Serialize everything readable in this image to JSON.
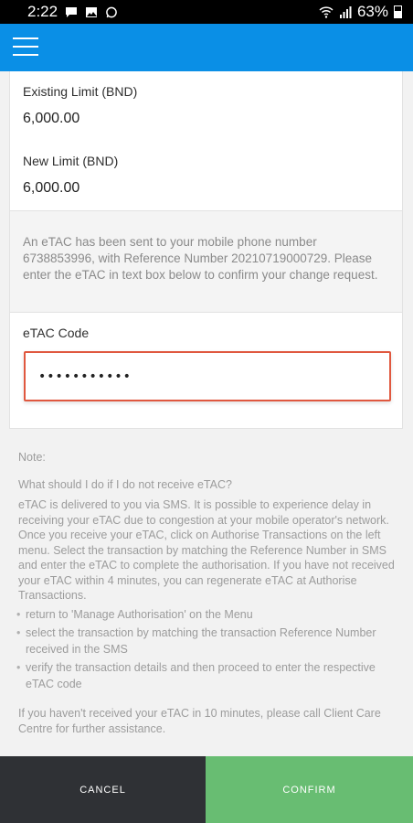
{
  "status_bar": {
    "time": "2:22",
    "battery": "63%"
  },
  "form": {
    "existing_limit_label": "Existing Limit (BND)",
    "existing_limit_value": "6,000.00",
    "new_limit_label": "New Limit (BND)",
    "new_limit_value": "6,000.00"
  },
  "info_message": "An eTAC has been sent to your mobile phone number 6738853996, with Reference Number 20210719000729. Please enter the eTAC in text box below to confirm your change request.",
  "etac": {
    "label": "eTAC Code",
    "value": "•••••••••••"
  },
  "note": {
    "heading": "Note:",
    "question": "What should I do if I do not receive eTAC?",
    "paragraph": "eTAC is delivered to you via SMS. It is possible to experience delay in receiving your eTAC due to congestion at your mobile operator's network. Once you receive your eTAC, click on Authorise Transactions on the left menu. Select the transaction by matching the Reference Number in SMS and enter the eTAC to complete the authorisation. If you have not received your eTAC within 4 minutes, you can regenerate eTAC at Authorise Transactions.",
    "bullets": [
      "return to 'Manage Authorisation' on the Menu",
      "select the transaction by matching the transaction Reference Number received in the SMS",
      "verify the transaction details and then proceed to enter the respective eTAC code"
    ],
    "footer": "If you haven't received your eTAC in 10 minutes, please call Client Care Centre for further assistance."
  },
  "buttons": {
    "cancel": "CANCEL",
    "confirm": "CONFIRM"
  },
  "colors": {
    "header": "#0a8fe6",
    "input_border": "#e0583f",
    "cancel_bg": "#2f3135",
    "confirm_bg": "#68bd72"
  }
}
